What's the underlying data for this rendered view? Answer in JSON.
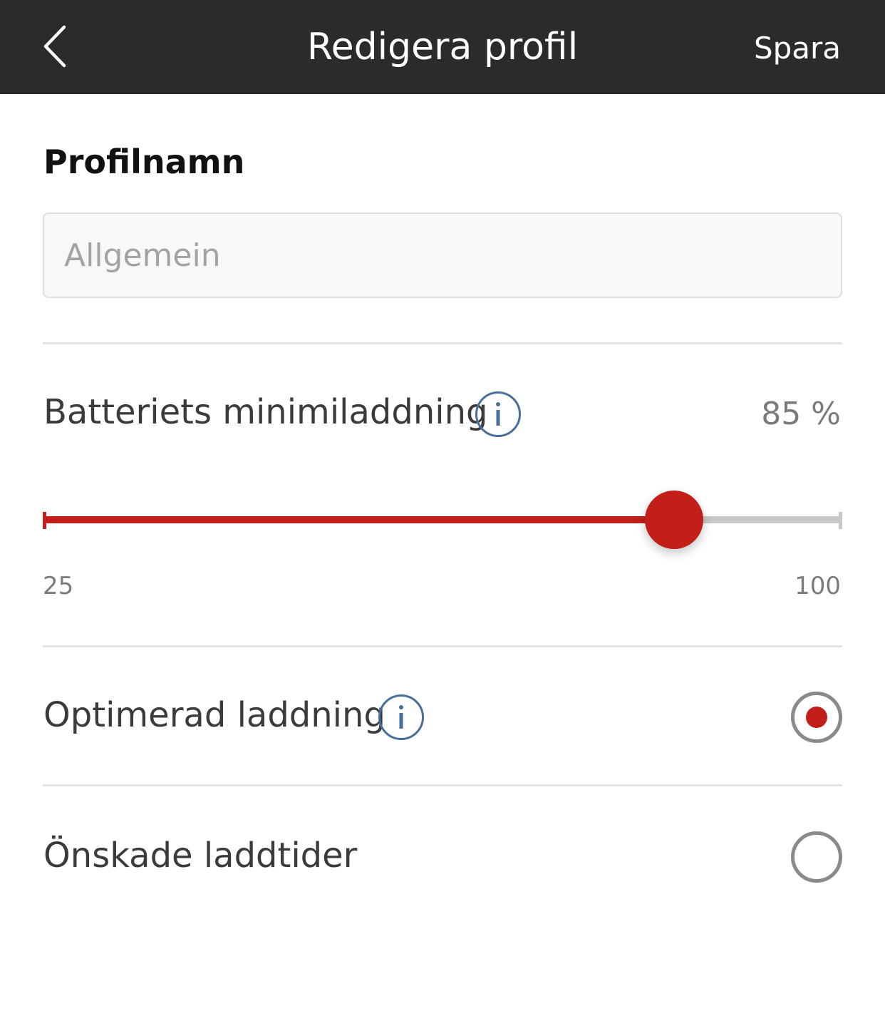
{
  "header": {
    "back_icon": "chevron-left-icon",
    "title": "Redigera profil",
    "save_label": "Spara"
  },
  "profile_name": {
    "label": "Profilnamn",
    "placeholder": "Allgemein",
    "value": ""
  },
  "battery_minimum": {
    "label": "Batteriets minimiladdning",
    "info_icon": "info-icon",
    "value_text": "85 %",
    "value": 85,
    "min": 25,
    "max": 100,
    "min_label": "25",
    "max_label": "100"
  },
  "options": [
    {
      "label": "Optimerad laddning",
      "has_info": true,
      "selected": true
    },
    {
      "label": "Önskade laddtider",
      "has_info": false,
      "selected": false
    }
  ],
  "colors": {
    "header_background": "#2b2b2e",
    "accent": "#c21f1a",
    "info_icon": "#4a6e9a",
    "track_inactive": "#c8c8c8",
    "radio_outline": "#8a8a8a"
  }
}
